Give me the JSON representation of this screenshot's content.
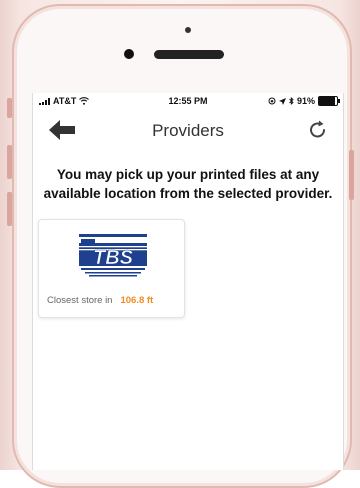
{
  "status_bar": {
    "carrier": "AT&T",
    "time": "12:55 PM",
    "battery": "91%",
    "battery_level": 0.91
  },
  "nav": {
    "title": "Providers",
    "back_icon": "back-arrow-icon",
    "refresh_icon": "refresh-icon"
  },
  "instructions": "You may pick up your printed files at any available location from the selected provider.",
  "providers": [
    {
      "logo_text": "TBS",
      "closest_label": "Closest store in",
      "distance": "106.8 ft"
    }
  ],
  "colors": {
    "accent": "#f28b1e",
    "logo_blue": "#1f3f8f",
    "phone_rose": "#e2b9b1"
  }
}
